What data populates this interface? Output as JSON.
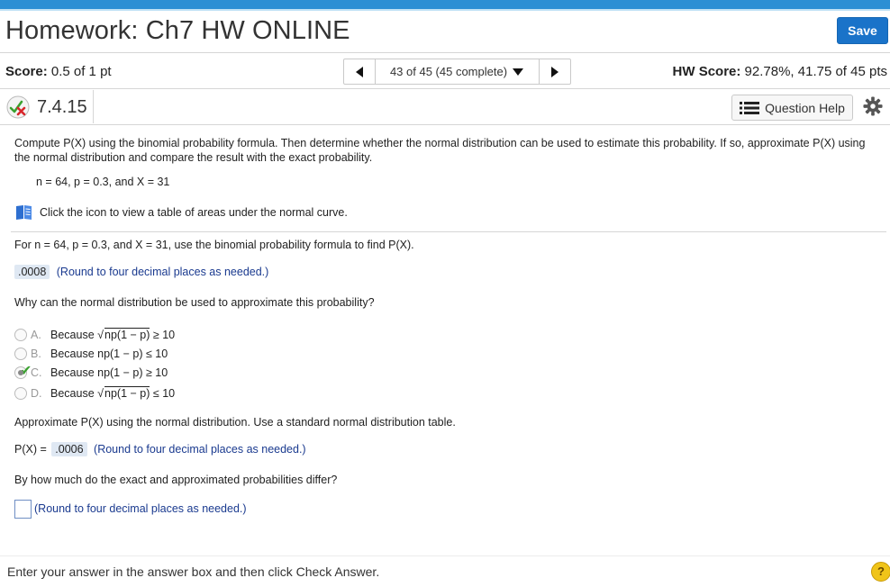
{
  "header": {
    "title": "Homework: Ch7 HW ONLINE",
    "save_label": "Save"
  },
  "status": {
    "score_label": "Score:",
    "score_value": "0.5 of 1 pt",
    "nav_text": "43 of 45 (45 complete)",
    "hw_score_label": "HW Score:",
    "hw_score_value": "92.78%, 41.75 of 45 pts"
  },
  "question": {
    "id": "7.4.15",
    "help_label": "Question Help",
    "prompt": "Compute P(X) using the binomial probability formula. Then determine whether the normal distribution can be used to estimate this probability. If so, approximate P(X) using the normal distribution and compare the result with the exact probability.",
    "params": "n = 64, p = 0.3, and X = 31",
    "table_link": "Click the icon to view a table of areas under the normal curve.",
    "part1_prompt": "For n = 64, p = 0.3, and X = 31, use the binomial probability formula to find P(X).",
    "part1_answer": ".0008",
    "part1_hint": "(Round to four decimal places as needed.)",
    "part2_prompt": "Why can the normal distribution be used to approximate this probability?",
    "options": [
      {
        "letter": "A.",
        "prefix": "Because ",
        "root": "np(1 − p)",
        "suffix": " ≥ 10",
        "selected": false
      },
      {
        "letter": "B.",
        "prefix": "Because np(1 − p) ≤ 10",
        "root": "",
        "suffix": "",
        "selected": false
      },
      {
        "letter": "C.",
        "prefix": "Because np(1 − p) ≥ 10",
        "root": "",
        "suffix": "",
        "selected": true
      },
      {
        "letter": "D.",
        "prefix": "Because ",
        "root": "np(1 − p)",
        "suffix": " ≤ 10",
        "selected": false
      }
    ],
    "sqrt_symbol": "√",
    "part3_prompt": "Approximate P(X) using the normal distribution. Use a standard normal distribution table.",
    "part3_label": "P(X) =",
    "part3_answer": ".0006",
    "part3_hint": "(Round to four decimal places as needed.)",
    "part4_prompt": "By how much do the exact and approximated probabilities differ?",
    "part4_hint": "(Round to four decimal places as needed.)"
  },
  "footer": {
    "instruction": "Enter your answer in the answer box and then click Check Answer.",
    "help_symbol": "?"
  },
  "colors": {
    "accent": "#2c8fd4",
    "save_button": "#1a73c9",
    "correct_check": "#3aa12f",
    "hint_text": "#1a3a8f"
  }
}
